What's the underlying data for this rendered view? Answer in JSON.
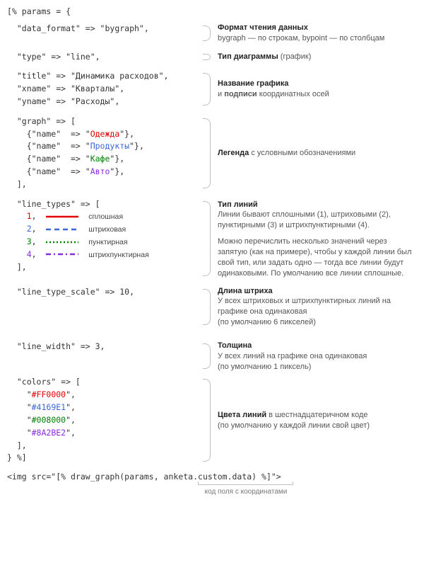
{
  "open": "[% params = {",
  "data_format": {
    "code": "  \"data_format\" => \"bygraph\",",
    "title": "Формат чтения данных",
    "desc": "bygraph — по строкам, bypoint — по столбцам"
  },
  "type": {
    "code": "  \"type\" => \"line\",",
    "title": "Тип диаграммы",
    "title_suffix": " (график)"
  },
  "title_block": {
    "l1": "  \"title\" => \"Динамика расходов\",",
    "l2": "  \"xname\" => \"Кварталы\",",
    "l3": "  \"yname\" => \"Расходы\",",
    "title": "Название графика",
    "desc_prefix": "и ",
    "desc_bold": "подписи",
    "desc_suffix": " координатных осей"
  },
  "graph": {
    "open": "  \"graph\" => [",
    "prefix": "    {\"name\"  => \"",
    "suffix": "\"},",
    "items": [
      "Одежда",
      "Продукты",
      "Кафе",
      "Авто"
    ],
    "close": "  ],",
    "title": "Легенда",
    "desc": " с условными обозначениями"
  },
  "line_types": {
    "open": "  \"line_types\" => [",
    "items": [
      {
        "n": "1",
        "label": "сплошная"
      },
      {
        "n": "2",
        "label": "штриховая"
      },
      {
        "n": "3",
        "label": "пунктирная"
      },
      {
        "n": "4",
        "label": "штрихпунктирная"
      }
    ],
    "close": "  ],",
    "title": "Тип линий",
    "desc1": "Линии бывают сплошными (1), штриховыми (2), пунктирными (3) и штрихпунктирными (4).",
    "desc2": "Можно перечислить несколько значений через запятую (как на примере), чтобы у каждой линии был свой тип, или задать одно — тогда все линии будут одинаковыми. По умолчанию все линии сплошные."
  },
  "line_type_scale": {
    "code": "  \"line_type_scale\" => 10,",
    "title": "Длина штриха",
    "desc1": "У всех штриховых и штрихпунктирных линий на графике она одинаковая",
    "desc2": "(по умолчанию 6 пикселей)"
  },
  "line_width": {
    "code": "  \"line_width\" => 3,",
    "title": "Толщина",
    "desc1": "У всех линий на графике она одинаковая",
    "desc2": "(по умолчанию 1 пиксель)"
  },
  "colors": {
    "open": "  \"colors\" => [",
    "items": [
      "#FF0000",
      "#4169E1",
      "#008000",
      "#8A2BE2"
    ],
    "close1": "  ],",
    "close2": "} %]",
    "title": "Цвета линий",
    "title_suffix": " в шестнадцатеричном коде",
    "desc": "(по умолчанию у каждой линии свой цвет)"
  },
  "footer": {
    "code": "<img src=\"[% draw_graph(params, anketa.custom.data) %]\">",
    "caption": "код поля с координатами"
  }
}
